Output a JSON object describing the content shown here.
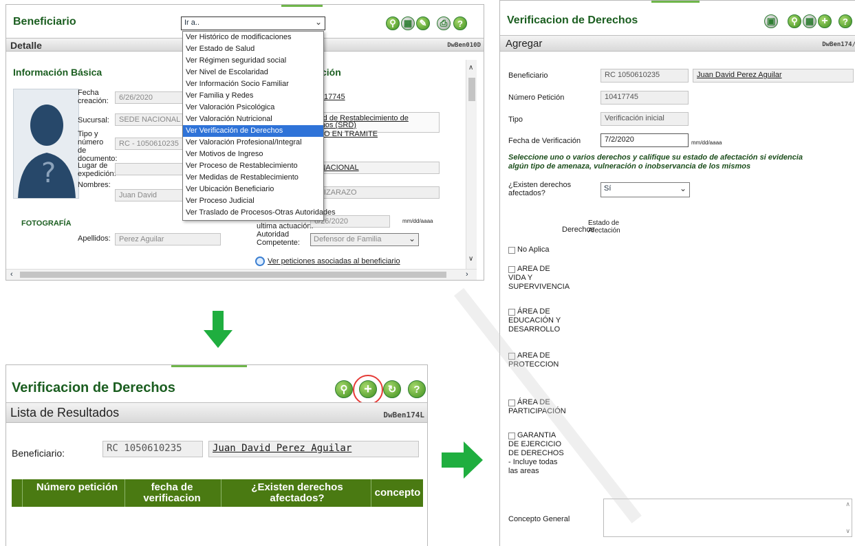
{
  "top": {
    "title": "Beneficiario",
    "detail_label": "Detalle",
    "code": "DwBen010D",
    "section_basic": "Información Básica",
    "section_right_partial": "ción",
    "photo_label": "FOTOGRAFÍA",
    "fields": {
      "fecha_label": "Fecha creación:",
      "fecha_value": "6/26/2020",
      "sucursal_label": "Sucursal:",
      "sucursal_value": "SEDE NACIONAL",
      "tipo_label": "Tipo y número de documento:",
      "tipo_value": "RC - 1050610235",
      "lugar_label": "Lugar de expedición:",
      "nombres_label": "Nombres:",
      "nombres_value": "Juan David",
      "apellidos_label": "Apellidos:",
      "apellidos_value": "Perez Aguilar"
    },
    "right": {
      "peticion": "17745",
      "proceso_1": "titud de Restablecimiento de",
      "proceso_2": "echos (SRD)",
      "estado": "O EN TRAMITE",
      "sede": "E NACIONAL",
      "apellido": "A LIZARAZO",
      "ultima_label": "ultima actuación:",
      "ultima_value": "6/26/2020",
      "date_hint": "mm/dd/aaaa",
      "autoridad_label": "Autoridad Competente:",
      "autoridad_value": "Defensor de Familia",
      "ver_link": "Ver peticiones asociadas al beneficiario"
    },
    "select_value": "Ir a..",
    "menu": [
      "Ver Histórico de modificaciones",
      "Ver Estado de Salud",
      "Ver Régimen seguridad social",
      "Ver Nivel de Escolaridad",
      "Ver Información Socio Familiar",
      "Ver Familia y Redes",
      "Ver Valoración Psicológica",
      "Ver Valoración Nutricional",
      "Ver Verificación de Derechos",
      "Ver Valoración Profesional/Integral",
      "Ver Motivos de Ingreso",
      "Ver Proceso de Restablecimiento",
      "Ver Medidas de Restablecimiento",
      "Ver Ubicación Beneficiario",
      "Ver Proceso Judicial",
      "Ver Traslado de Procesos-Otras Autoridades"
    ],
    "menu_selected_index": 8
  },
  "bottom": {
    "title": "Verificacion de Derechos",
    "list_label": "Lista de Resultados",
    "code": "DwBen174L",
    "beneficiario_label": "Beneficiario:",
    "doc_value": "RC 1050610235",
    "name_value": "Juan David Perez Aguilar",
    "columns": [
      "Número petición",
      "fecha de verificacion",
      "¿Existen derechos afectados?",
      "concepto"
    ]
  },
  "right": {
    "title": "Verificacion de Derechos",
    "add_label": "Agregar",
    "code": "DwBen174/",
    "beneficiario_label": "Beneficiario",
    "beneficiario_doc": "RC 1050610235",
    "beneficiario_name": "Juan David Perez Aguilar",
    "numero_label": "Número Petición",
    "numero_value": "10417745",
    "tipo_label": "Tipo",
    "tipo_value": "Verificación inicial",
    "fecha_label": "Fecha de Verificación",
    "fecha_value": "7/2/2020",
    "fecha_hint": "mm/dd/aaaa",
    "instruction": "Seleccione uno o varios derechos y califique su estado de afectación si evidencia algún tipo de amenaza, vulneración o inobservancia de los mismos",
    "existen_label": "¿Existen derechos afectados?",
    "existen_value": "Sí",
    "col_derechos": "Derechos",
    "col_estado": "Estado de Afectación",
    "rights": [
      "No Aplica",
      "AREA DE VIDA Y SUPERVIVENCIA",
      "ÁREA DE EDUCACIÓN Y DESARROLLO",
      "AREA DE PROTECCION",
      "ÁREA DE PARTICIPACIÓN",
      "GARANTIA DE EJERCICIO DE DERECHOS - Incluye todas las areas"
    ],
    "concepto_label": "Concepto General"
  },
  "colors": {
    "brand_green": "#1b5e20",
    "table_green": "#4a7a12",
    "arrow_green": "#1fae3f",
    "highlight_circle": "#e53935",
    "menu_selected": "#2f73d8"
  }
}
